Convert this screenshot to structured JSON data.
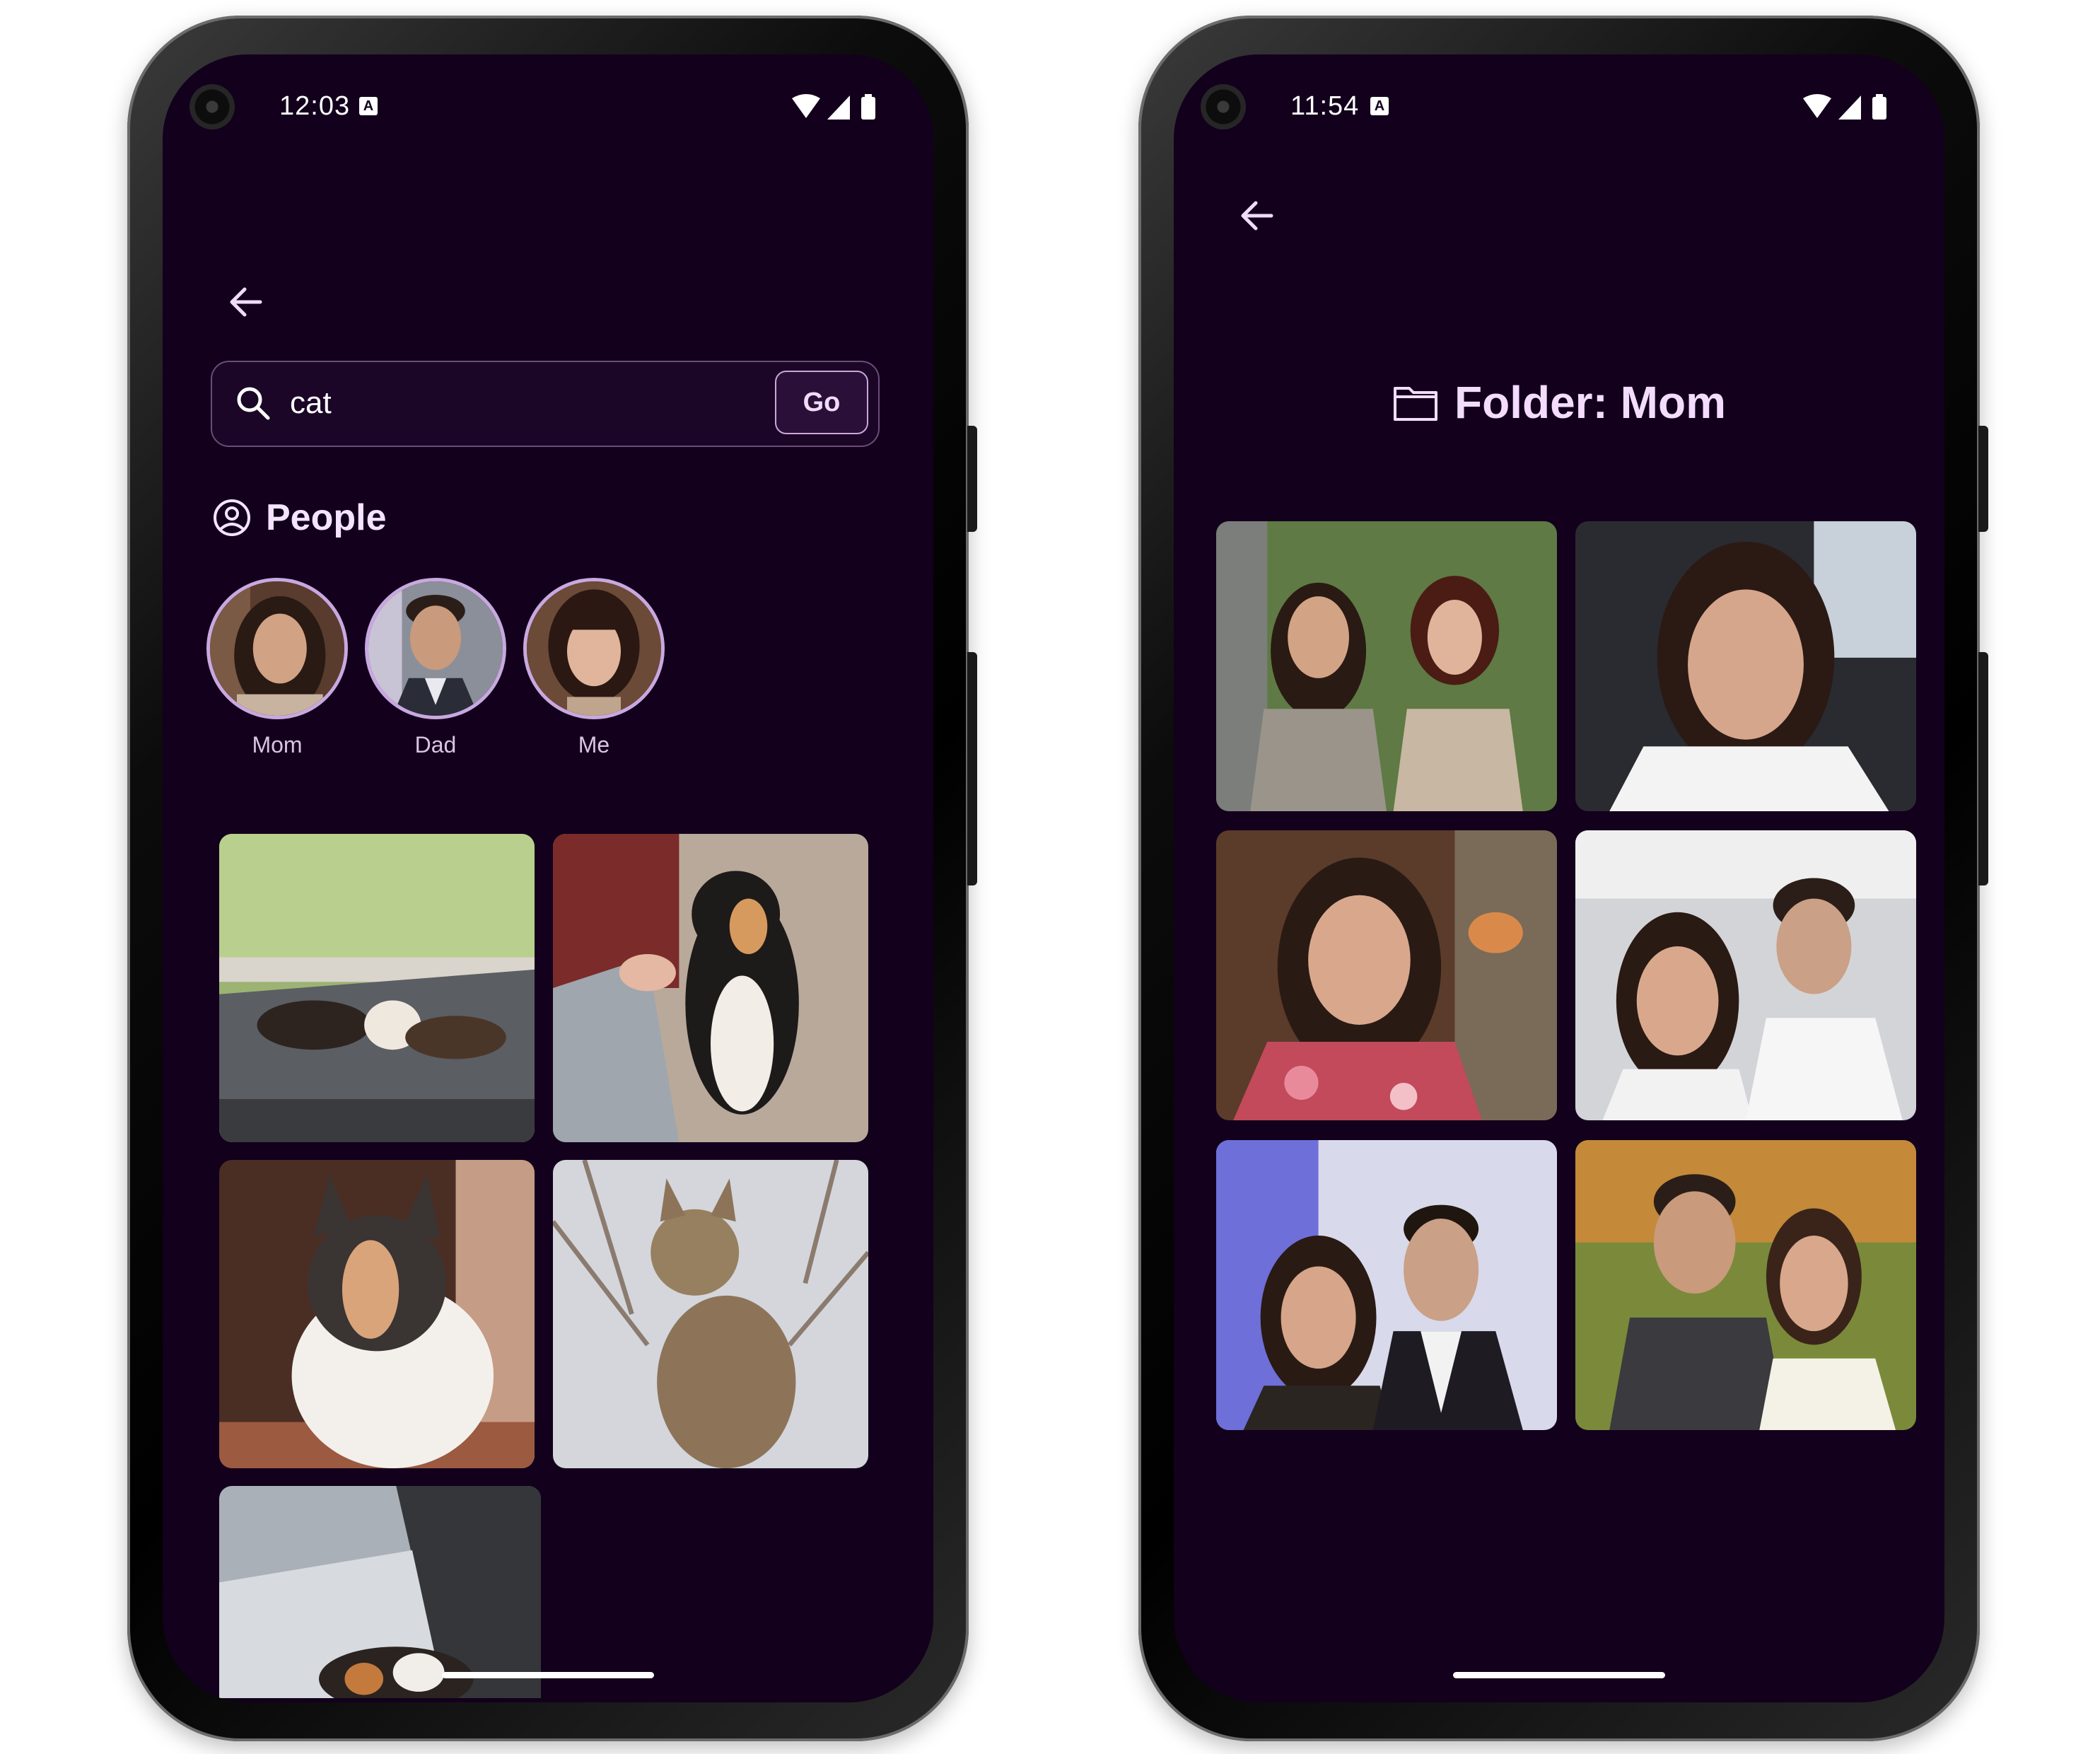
{
  "left_screen": {
    "status": {
      "time": "12:03",
      "notification_badge": "A"
    },
    "search": {
      "value": "cat",
      "go_label": "Go"
    },
    "people_section": {
      "title": "People",
      "people": [
        {
          "name": "Mom"
        },
        {
          "name": "Dad"
        },
        {
          "name": "Me"
        }
      ]
    },
    "results_count_visible": 5
  },
  "right_screen": {
    "status": {
      "time": "11:54",
      "notification_badge": "A"
    },
    "folder_title": "Folder: Mom",
    "photos_visible": 6
  },
  "icons": [
    "back-arrow-icon",
    "search-icon",
    "person-circle-icon",
    "folder-icon",
    "wifi-icon",
    "signal-icon",
    "battery-icon"
  ],
  "colors": {
    "background": "#12001c",
    "accent": "#c9a8e0",
    "title_text": "#f4dcff"
  }
}
